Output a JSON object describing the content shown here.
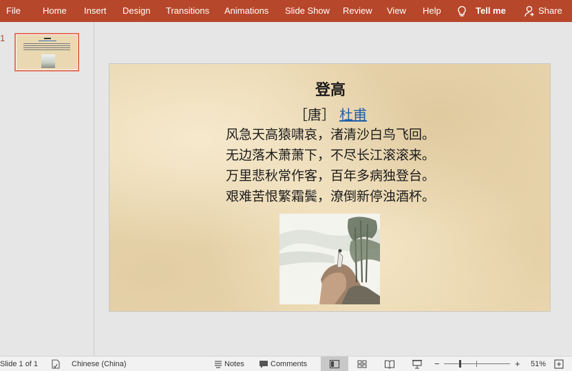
{
  "ribbon": {
    "tabs": [
      {
        "label": "File"
      },
      {
        "label": "Home"
      },
      {
        "label": "Insert"
      },
      {
        "label": "Design"
      },
      {
        "label": "Transitions"
      },
      {
        "label": "Animations"
      },
      {
        "label": "Slide Show"
      },
      {
        "label": "Review"
      },
      {
        "label": "View"
      },
      {
        "label": "Help"
      }
    ],
    "tell_me": "Tell me",
    "share": "Share"
  },
  "thumbnails": {
    "number": "1"
  },
  "slide": {
    "title": "登高",
    "byline_prefix": "［唐］",
    "author": "杜甫",
    "lines": [
      "风急天高猿啸哀，渚清沙白鸟飞回。",
      "无边落木萧萧下，不尽长江滚滚来。",
      "万里悲秋常作客，百年多病独登台。",
      "艰难苦恨繁霜鬓，潦倒新停浊酒杯。"
    ]
  },
  "status": {
    "slide_info": "Slide 1 of 1",
    "language": "Chinese (China)",
    "notes": "Notes",
    "comments": "Comments",
    "zoom_minus": "−",
    "zoom_plus": "+",
    "zoom": "51%"
  },
  "colors": {
    "ribbon": "#b7472a",
    "thumbnail_border": "#e2725b",
    "link": "#1f5fa8",
    "slide_bg": "#ead7b0"
  }
}
